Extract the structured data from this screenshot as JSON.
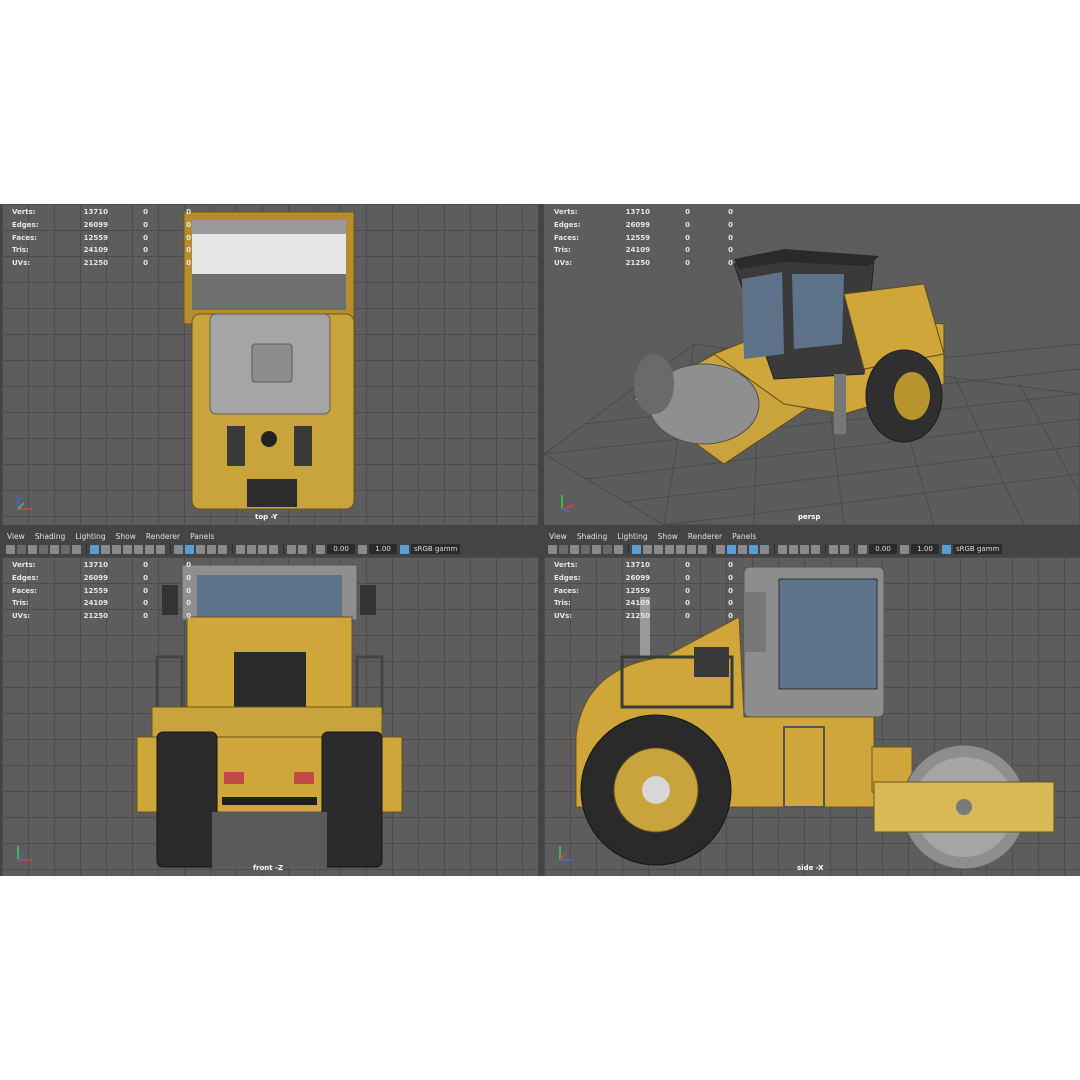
{
  "stats": [
    {
      "label": "Verts:",
      "v1": "13710",
      "v2": "0",
      "v3": "0"
    },
    {
      "label": "Edges:",
      "v1": "26099",
      "v2": "0",
      "v3": "0"
    },
    {
      "label": "Faces:",
      "v1": "12559",
      "v2": "0",
      "v3": "0"
    },
    {
      "label": "Tris:",
      "v1": "24109",
      "v2": "0",
      "v3": "0"
    },
    {
      "label": "UVs:",
      "v1": "21250",
      "v2": "0",
      "v3": "0"
    }
  ],
  "viewports": {
    "top": {
      "camera": "top -Y"
    },
    "persp": {
      "camera": "persp"
    },
    "front": {
      "camera": "front -Z"
    },
    "side": {
      "camera": "side -X"
    }
  },
  "menu": {
    "view": "View",
    "shading": "Shading",
    "lighting": "Lighting",
    "show": "Show",
    "renderer": "Renderer",
    "panels": "Panels"
  },
  "toolbar": {
    "exposure": "0.00",
    "gamma": "1.00",
    "colorspace": "sRGB gamm"
  },
  "colors": {
    "viewport_bg": "#5d5d5d",
    "grid_line": "#4c4c4c",
    "ui_bg": "#444444",
    "body_yellow": "#cfa63a",
    "cab_glass": "#5e7289",
    "steel": "#a9a9a9"
  }
}
